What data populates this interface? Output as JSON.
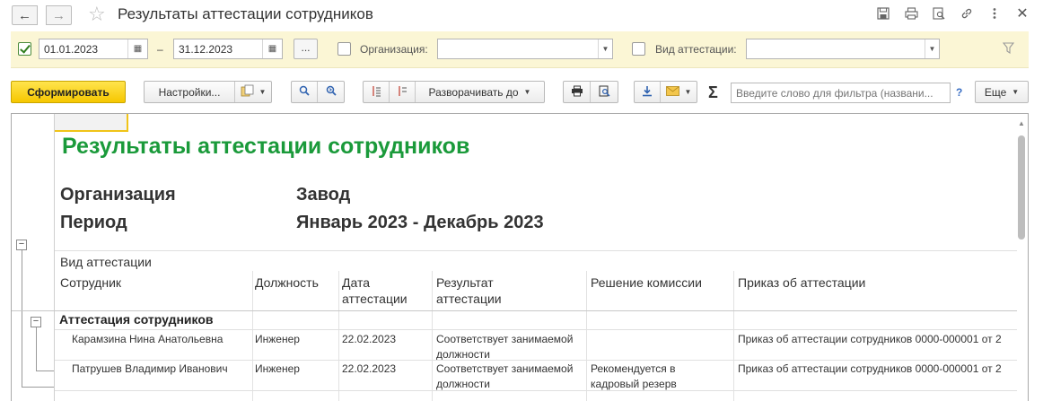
{
  "window": {
    "title": "Результаты аттестации сотрудников"
  },
  "filters": {
    "date_from": "01.01.2023",
    "date_to": "31.12.2023",
    "dash": "–",
    "dots_label": "...",
    "org_label": "Организация:",
    "org_value": "",
    "type_label": "Вид аттестации:",
    "type_value": ""
  },
  "toolbar": {
    "generate_label": "Сформировать",
    "settings_label": "Настройки...",
    "expand_label": "Разворачивать до",
    "search_placeholder": "Введите слово для фильтра (названи...",
    "help_label": "?",
    "more_label": "Еще"
  },
  "report": {
    "title": "Результаты аттестации сотрудников",
    "meta": [
      {
        "label": "Организация",
        "value": "Завод"
      },
      {
        "label": "Период",
        "value": "Январь 2023 - Декабрь 2023"
      }
    ],
    "group_header": "Вид аттестации",
    "columns": [
      {
        "line1": "Сотрудник",
        "line2": ""
      },
      {
        "line1": "Должность",
        "line2": ""
      },
      {
        "line1": "Дата",
        "line2": "аттестации"
      },
      {
        "line1": "Результат",
        "line2": "аттестации"
      },
      {
        "line1": "Решение комиссии",
        "line2": ""
      },
      {
        "line1": "Приказ об аттестации",
        "line2": ""
      }
    ],
    "group_title": "Аттестация сотрудников",
    "rows": [
      {
        "employee": "Карамзина Нина Анатольевна",
        "position": "Инженер",
        "date": "22.02.2023",
        "result_1": "Соответствует занимаемой",
        "result_2": "должности",
        "decision_1": "",
        "decision_2": "",
        "order": "Приказ об аттестации сотрудников 0000-000001 от 2"
      },
      {
        "employee": "Патрушев Владимир Иванович",
        "position": "Инженер",
        "date": "22.02.2023",
        "result_1": "Соответствует занимаемой",
        "result_2": "должности",
        "decision_1": "Рекомендуется в",
        "decision_2": "кадровый резерв",
        "order": "Приказ об аттестации сотрудников 0000-000001 от 2"
      }
    ]
  },
  "colors": {
    "accent_yellow": "#f6c700",
    "title_green": "#1a9a3a",
    "filter_bg": "#fbf6d5"
  }
}
